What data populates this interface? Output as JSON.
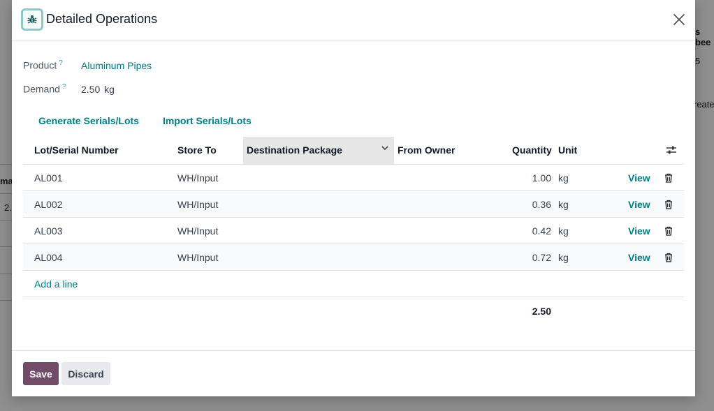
{
  "background": {
    "fragments": [
      "s bee",
      "5",
      "reate",
      "mar",
      "2."
    ]
  },
  "dialog": {
    "title": "Detailed Operations",
    "product_label": "Product",
    "product_value": "Aluminum Pipes",
    "demand_label": "Demand",
    "demand_value": "2.50",
    "demand_unit": "kg",
    "help_mark": "?",
    "generate_label": "Generate Serials/Lots",
    "import_label": "Import Serials/Lots"
  },
  "table": {
    "columns": [
      "Lot/Serial Number",
      "Store To",
      "Destination Package",
      "From Owner",
      "Quantity",
      "Unit"
    ],
    "rows": [
      {
        "lot": "AL001",
        "store_to": "WH/Input",
        "package": "",
        "owner": "",
        "quantity": "1.00",
        "unit": "kg",
        "action": "View"
      },
      {
        "lot": "AL002",
        "store_to": "WH/Input",
        "package": "",
        "owner": "",
        "quantity": "0.36",
        "unit": "kg",
        "action": "View"
      },
      {
        "lot": "AL003",
        "store_to": "WH/Input",
        "package": "",
        "owner": "",
        "quantity": "0.42",
        "unit": "kg",
        "action": "View"
      },
      {
        "lot": "AL004",
        "store_to": "WH/Input",
        "package": "",
        "owner": "",
        "quantity": "0.72",
        "unit": "kg",
        "action": "View"
      }
    ],
    "add_line_label": "Add a line",
    "total_quantity": "2.50"
  },
  "footer": {
    "save_label": "Save",
    "discard_label": "Discard"
  },
  "icons": {
    "title": "bug-icon",
    "close": "close-icon",
    "column_settings": "sliders-icon",
    "delete": "trash-icon",
    "sort": "chevron-down-icon"
  },
  "colors": {
    "accent": "#017e84",
    "primary_button": "#714b67",
    "secondary_button": "#e7e9ed"
  }
}
